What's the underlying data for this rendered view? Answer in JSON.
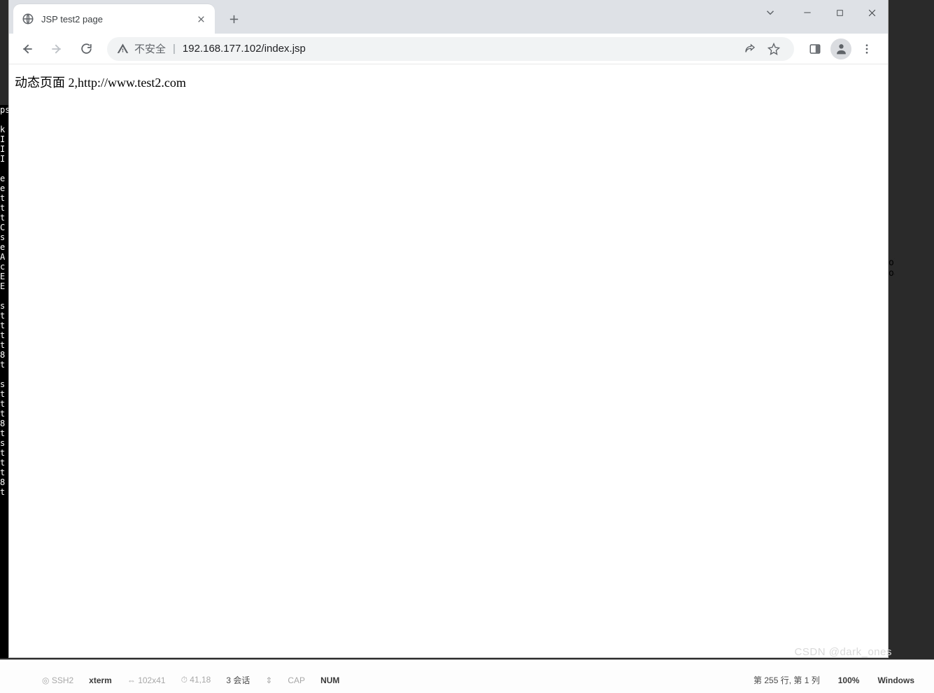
{
  "tab": {
    "title": "JSP test2 page"
  },
  "address": {
    "security_label": "不安全",
    "url_display": "192.168.177.102/index.jsp"
  },
  "page": {
    "body_text": "动态页面 2,http://www.test2.com"
  },
  "statusbar": {
    "ssh": "SSH2",
    "term": "xterm",
    "size": "102x41",
    "uptime": "41,18",
    "sessions": "3 会话",
    "cap": "CAP",
    "num": "NUM",
    "line_col": "第 255 行, 第 1 列",
    "zoom": "100%",
    "os": "Windows"
  },
  "watermark": "CSDN @dark_ones",
  "left_strip_text": "ps\n\nk\nI\nI\nI\n\ne\ne\nt\nt\nt\nC\ns\ne\nA\nc\nE\nE\n\ns\nt\nt\nt\nt\n8\nt\n\ns\nt\nt\nt\n8\nt\ns\nt\nt\nt\n8\nt",
  "right_strip_text": "ol\noa"
}
